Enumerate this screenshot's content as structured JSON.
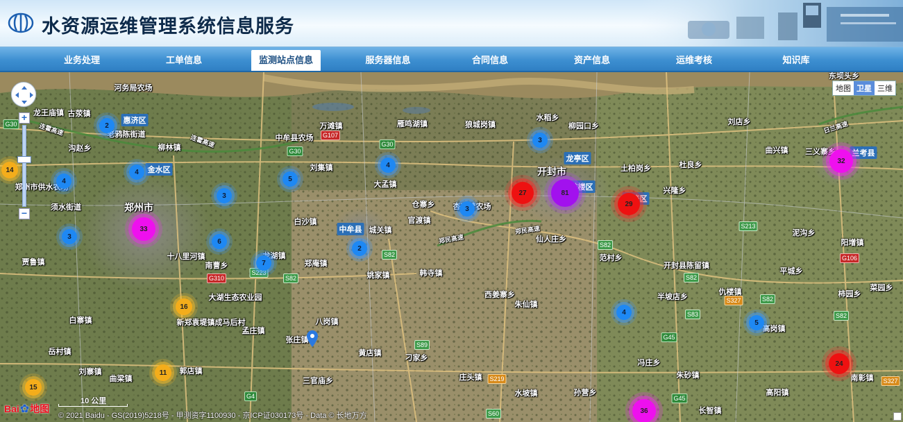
{
  "header": {
    "title": "水资源运维管理系统信息服务",
    "logo_icon": "water-drop-logo-icon"
  },
  "nav": {
    "items": [
      {
        "label": "业务处理",
        "active": false
      },
      {
        "label": "工单信息",
        "active": false
      },
      {
        "label": "监测站点信息",
        "active": true
      },
      {
        "label": "服务器信息",
        "active": false
      },
      {
        "label": "合同信息",
        "active": false
      },
      {
        "label": "资产信息",
        "active": false
      },
      {
        "label": "运维考核",
        "active": false
      },
      {
        "label": "知识库",
        "active": false
      }
    ]
  },
  "map": {
    "type_buttons": [
      "地图",
      "卫星",
      "三维"
    ],
    "active_type": "卫星",
    "zoom_in": "+",
    "zoom_out": "−",
    "scale_label": "10 公里",
    "logo_text": [
      "Bai",
      "地图"
    ],
    "copyright": "© 2021 Baidu - GS(2019)5218号 - 甲测资字1100930 - 京ICP证030173号 - Data © 长地万方",
    "districts": [
      "惠济区",
      "金水区",
      "龙亭区",
      "中牟县",
      "鼓楼区",
      "祥符区",
      "兰考县"
    ],
    "place_labels": {
      "l1": "河务局农场",
      "l2": "古荥镇",
      "l3": "老鸦陈街道",
      "l4": "柳林镇",
      "l5": "沟赵乡",
      "l6": "郑州市",
      "l7": "须水街道",
      "l8": "郑州市供水农场",
      "l9": "十八里河镇",
      "l10": "贾鲁镇",
      "l11": "南曹乡",
      "l12": "大湖生态农业园",
      "l13": "白寨镇",
      "l14": "新郑袁堤镇成马后村",
      "l15": "岳村镇",
      "l16": "郭店镇",
      "l17": "曲梁镇",
      "l18": "中牟县农场",
      "l19": "万滩镇",
      "l20": "刘集镇",
      "l21": "大孟镇",
      "l22": "白沙镇",
      "l23": "城关镇",
      "l24": "官渡镇",
      "l25": "仓寨乡",
      "l26": "郑庵镇",
      "l27": "姚家镇",
      "l28": "韩寺镇",
      "l29": "八岗镇",
      "l30": "张庄镇",
      "l31": "孟庄镇",
      "l32": "黄店镇",
      "l33": "刁家乡",
      "l34": "三官庙乡",
      "l35": "庄头镇",
      "l36": "水坡镇",
      "l37": "孙营乡",
      "l38": "雁鸣湖镇",
      "l39": "狼城岗镇",
      "l40": "水稻乡",
      "l41": "柳园口乡",
      "l42": "开封市",
      "l43": "土柏岗乡",
      "l44": "杏花营农场",
      "l45": "仙人庄乡",
      "l46": "范村乡",
      "l47": "西姜寨乡",
      "l48": "朱仙镇",
      "l49": "半坡店乡",
      "l50": "开封县陈留镇",
      "l51": "兴隆乡",
      "l52": "杜良乡",
      "l53": "曲兴镇",
      "l54": "刘店乡",
      "l55": "三义寨乡",
      "l56": "东坝头乡",
      "l57": "泥沟乡",
      "l58": "阳增镇",
      "l59": "平城乡",
      "l60": "仇楼镇",
      "l61": "高岗镇",
      "l62": "柿园乡",
      "l63": "冯庄乡",
      "l64": "朱砂镇",
      "l65": "长智镇",
      "l66": "高阳镇",
      "l67": "刘寨镇",
      "l68": "南彰镇",
      "l69": "龙湖镇",
      "l70": "菜园乡",
      "l71": "龙王庙镇"
    },
    "roads": [
      "G30",
      "G107",
      "G30",
      "G30",
      "S82",
      "S82",
      "G310",
      "S223",
      "S89",
      "S219",
      "G4",
      "S60",
      "S82",
      "S82",
      "S83",
      "S82",
      "S327",
      "S82",
      "G106",
      "S213",
      "G45",
      "G45",
      "S327"
    ],
    "road_labels": [
      "连霍高速",
      "郑民高速",
      "郑民高速",
      "连霍高速",
      "日兰高速"
    ],
    "clusters": [
      {
        "count": "14",
        "color": "orange"
      },
      {
        "count": "2",
        "color": "blue"
      },
      {
        "count": "4",
        "color": "blue"
      },
      {
        "count": "4",
        "color": "blue"
      },
      {
        "count": "3",
        "color": "blue"
      },
      {
        "count": "33",
        "color": "magenta"
      },
      {
        "count": "3",
        "color": "blue"
      },
      {
        "count": "5",
        "color": "blue"
      },
      {
        "count": "6",
        "color": "blue"
      },
      {
        "count": "7",
        "color": "blue"
      },
      {
        "count": "4",
        "color": "blue"
      },
      {
        "count": "2",
        "color": "blue"
      },
      {
        "count": "16",
        "color": "orange"
      },
      {
        "count": "11",
        "color": "orange"
      },
      {
        "count": "15",
        "color": "orange"
      },
      {
        "count": "3",
        "color": "blue"
      },
      {
        "count": "3",
        "color": "blue"
      },
      {
        "count": "27",
        "color": "red"
      },
      {
        "count": "81",
        "color": "purple"
      },
      {
        "count": "29",
        "color": "red"
      },
      {
        "count": "32",
        "color": "magenta"
      },
      {
        "count": "4",
        "color": "blue"
      },
      {
        "count": "5",
        "color": "blue"
      },
      {
        "count": "24",
        "color": "red"
      },
      {
        "count": "36",
        "color": "magenta"
      }
    ]
  }
}
